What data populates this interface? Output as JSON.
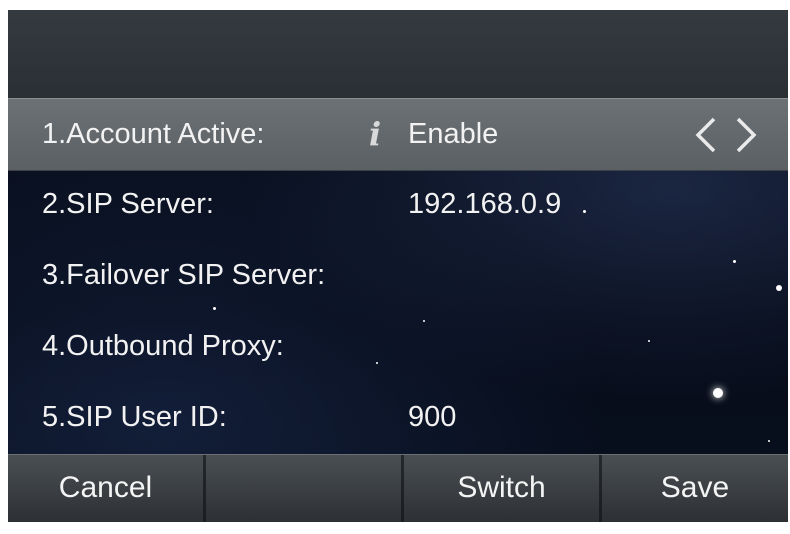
{
  "settings": {
    "rows": [
      {
        "label": "1.Account Active:",
        "value": "Enable",
        "selected": true,
        "has_info": true,
        "has_arrows": true
      },
      {
        "label": "2.SIP Server:",
        "value": "192.168.0.9"
      },
      {
        "label": "3.Failover SIP Server:",
        "value": ""
      },
      {
        "label": "4.Outbound Proxy:",
        "value": ""
      },
      {
        "label": "5.SIP User ID:",
        "value": "900"
      }
    ]
  },
  "softkeys": {
    "cancel": "Cancel",
    "blank": "",
    "switch": "Switch",
    "save": "Save"
  },
  "icons": {
    "info": "info-icon",
    "left": "chevron-left-icon",
    "right": "chevron-right-icon"
  },
  "colors": {
    "selected_row": "#5f6569",
    "titlebar": "#2f3439",
    "softkey_bar": "#3e4246",
    "text": "#f2f2f2"
  }
}
